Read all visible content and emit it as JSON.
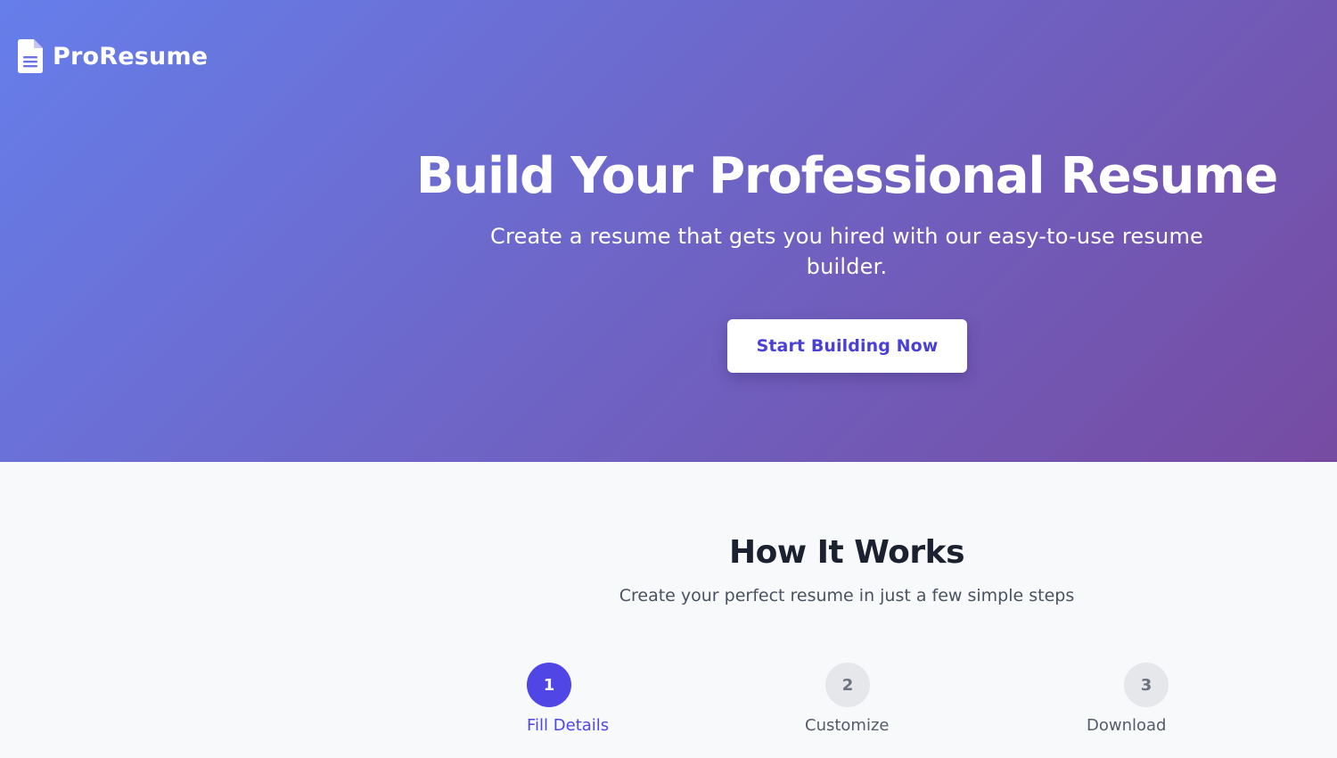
{
  "brand": {
    "name": "ProResume",
    "icon": "file-document-icon"
  },
  "hero": {
    "title": "Build Your Professional Resume",
    "subtitle": "Create a resume that gets you hired with our easy-to-use resume builder.",
    "cta_label": "Start Building Now"
  },
  "how_it_works": {
    "title": "How It Works",
    "subtitle": "Create your perfect resume in just a few simple steps",
    "steps": [
      {
        "number": "1",
        "label": "Fill Details",
        "state": "active"
      },
      {
        "number": "2",
        "label": "Customize",
        "state": "inactive"
      },
      {
        "number": "3",
        "label": "Download",
        "state": "inactive"
      }
    ]
  },
  "colors": {
    "gradient_start": "#667eea",
    "gradient_end": "#764ba2",
    "accent": "#4f46e5",
    "heading_dark": "#1c2130",
    "inactive_step": "#e6e7eb"
  }
}
